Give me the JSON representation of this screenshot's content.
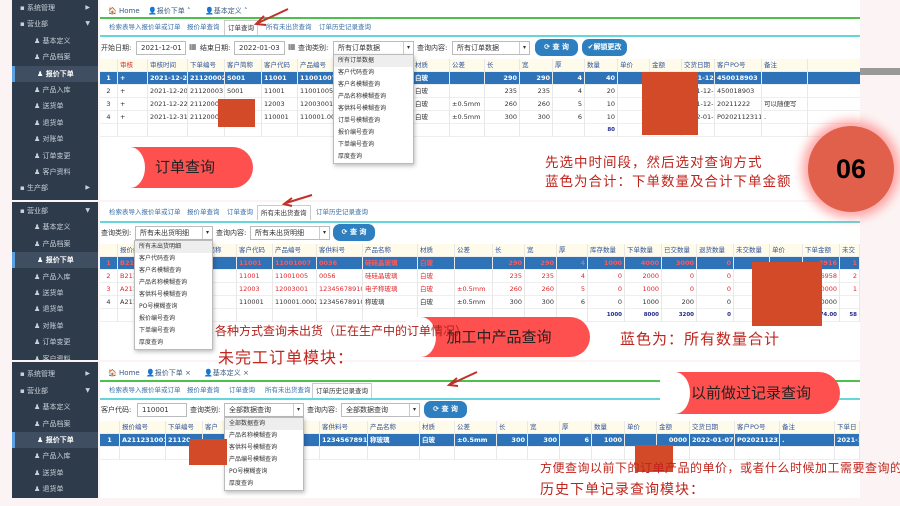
{
  "colors": {
    "accent": "#2d7fbf",
    "selected_row": "#2e72b8",
    "callout": "#ff5050",
    "note_text": "#c0241c",
    "redaction": "#d24a28"
  },
  "window_tabs": [
    {
      "label": "Home",
      "icon": "home-icon"
    },
    {
      "label": "报价下单",
      "icon": "user-icon"
    },
    {
      "label": "基本定义",
      "icon": "user-icon"
    }
  ],
  "sub_tabs": [
    "检索表导入报价单或订单",
    "报价单查询",
    "订单查询",
    "所有未出货查询",
    "订单历史记录查询"
  ],
  "sidebar": {
    "groups": [
      "系统管理",
      "营业部",
      "生产部"
    ],
    "items": [
      "基本定义",
      "产品档案",
      "报价下单",
      "产品入库",
      "送货单",
      "退货单",
      "对账单",
      "订单变更",
      "客户资料"
    ],
    "active": "报价下单"
  },
  "panel1": {
    "start_label": "开始日期:",
    "start_value": "2021-12-01",
    "end_label": "结束日期:",
    "end_value": "2022-01-03",
    "type_label": "查询类别:",
    "type_value": "所有订单数据",
    "content_label": "查询内容:",
    "content_value": "所有订单数据",
    "query_button": "查 询",
    "unlock_button": "解锁更改",
    "dropdown": [
      "所有订单数据",
      "客户代码查询",
      "客户名模糊查询",
      "产品名称模糊查询",
      "客供料号模糊查询",
      "订单号模糊查询",
      "报价编号查询",
      "下单编号查询",
      "厚度查询"
    ],
    "columns": [
      "",
      "审核",
      "审核时间",
      "下单编号",
      "客户简称",
      "客户代码",
      "产品编号",
      "",
      "称",
      "材质",
      "公差",
      "长",
      "宽",
      "厚",
      "数量",
      "单价",
      "金额",
      "交货日期",
      "客户PO号",
      "备注"
    ],
    "rows": [
      [
        "1",
        "+",
        "2021-12-20",
        "21120002",
        "S001",
        "11001",
        "11001007",
        "",
        "玻璃",
        "白玻",
        "",
        "290",
        "290",
        "4",
        "40",
        "",
        "3916",
        "2021-12-20",
        "450018903",
        ""
      ],
      [
        "2",
        "+",
        "2021-12-20",
        "21120003",
        "S001",
        "11001",
        "11001005",
        "",
        "玻璃",
        "白玻",
        "",
        "235",
        "235",
        "4",
        "20",
        "",
        "6958",
        "2021-12-20",
        "450018903",
        ""
      ],
      [
        "3",
        "+",
        "2021-12-22",
        "21120004",
        "",
        "12003",
        "12003001",
        "",
        "玻璃",
        "白玻",
        "±0.5mm",
        "260",
        "260",
        "5",
        "10",
        "",
        "0000",
        "2021-12-22",
        "20211222",
        "可以随便写"
      ],
      [
        "4",
        "+",
        "2021-12-31",
        "21120005",
        "",
        "110001",
        "110001.00",
        "",
        "",
        "白玻",
        "±0.5mm",
        "300",
        "300",
        "6",
        "10",
        "",
        "0000",
        "2022-01-07",
        "P0202112311",
        "."
      ]
    ],
    "total": [
      "",
      "",
      "",
      "",
      "",
      "",
      "",
      "",
      "",
      "",
      "",
      "",
      "",
      "",
      "80",
      "",
      "74.00",
      "",
      "",
      ""
    ],
    "callout": "订单查询",
    "note_lines": [
      "先选中时间段，然后选对查询方式",
      "蓝色为合计：下单数量及合计下单金额"
    ],
    "badge": "06"
  },
  "panel2": {
    "type_label": "查询类别:",
    "type_value": "所有未出货明细",
    "content_label": "查询内容:",
    "content_value": "所有未出货明细",
    "query_button": "查 询",
    "dropdown": [
      "所有未出货明细",
      "客户代码查询",
      "客户名模糊查询",
      "产品名称模糊查询",
      "客供料号模糊查询",
      "PO号模糊查询",
      "报价编号查询",
      "下单编号查询",
      "厚度查询"
    ],
    "columns": [
      "",
      "报价编号",
      "",
      "户简称",
      "客户代码",
      "产品编号",
      "客供料号",
      "产品名称",
      "材质",
      "公差",
      "长",
      "宽",
      "厚",
      "库存数量",
      "下单数量",
      "已交数量",
      "退货数量",
      "未交数量",
      "单价",
      "下单金额",
      "未交"
    ],
    "rows": [
      [
        "1",
        "B211",
        "",
        "",
        "11001",
        "11001007",
        "0036",
        "硅硅晶玻璃",
        "白玻",
        "",
        "290",
        "290",
        "4",
        "1000",
        "4000",
        "3000",
        "0",
        "",
        "",
        "3916",
        "1"
      ],
      [
        "2",
        "B211",
        "",
        "",
        "11001",
        "11001005",
        "0056",
        "硅硅晶玻璃",
        "白玻",
        "",
        "235",
        "235",
        "4",
        "0",
        "2000",
        "0",
        "0",
        "",
        "",
        "6958",
        "2"
      ],
      [
        "3",
        "A211",
        "",
        "",
        "12003",
        "12003001",
        "12345678910",
        "电子称玻璃",
        "白玻",
        "±0.5mm",
        "260",
        "260",
        "5",
        "0",
        "1000",
        "0",
        "0",
        "",
        "",
        "0000",
        "1"
      ],
      [
        "4",
        "A211",
        "",
        "",
        "110001",
        "110001.0002",
        "12345678910",
        "称玻璃",
        "白玻",
        "±0.5mm",
        "300",
        "300",
        "6",
        "0",
        "1000",
        "200",
        "0",
        "",
        "",
        "0000",
        ""
      ]
    ],
    "total": [
      "",
      "",
      "",
      "",
      "",
      "",
      "",
      "",
      "",
      "",
      "",
      "",
      "",
      "1000",
      "8000",
      "3200",
      "0",
      "",
      "",
      "74.00",
      "58"
    ],
    "note_top": "各种方式查询未出货（正在生产中的订单情况）",
    "callout": "加工中产品查询",
    "module_title": "未完工订单模块：",
    "note_right": "蓝色为：所有数量合计"
  },
  "panel3": {
    "code_label": "客户代码:",
    "code_value": "110001",
    "type_label": "查询类别:",
    "type_value": "全部数据查询",
    "content_label": "查询内容:",
    "content_value": "全部数据查询",
    "query_button": "查 询",
    "dropdown": [
      "全部数据查询",
      "产品名称模糊查询",
      "客供料号模糊查询",
      "产品编号模糊查询",
      "PO号模糊查询",
      "厚度查询"
    ],
    "columns": [
      "",
      "报价编号",
      "下单编号",
      "客户",
      "",
      "号",
      "客供料号",
      "产品名称",
      "材质",
      "公差",
      "长",
      "宽",
      "厚",
      "数量",
      "单价",
      "金额",
      "交货日期",
      "客户PO号",
      "备注",
      "下单日"
    ],
    "rows": [
      [
        "1",
        "A211231001",
        "21120",
        "",
        "",
        "0002",
        "12345678910",
        "称玻璃",
        "白玻",
        "±0.5mm",
        "300",
        "300",
        "6",
        "1000",
        "",
        "0000",
        "2022-01-07",
        "P0202112311",
        ".",
        "2021-1"
      ]
    ],
    "callout": "以前做过记录查询",
    "note_lines": [
      "方便查询以前下的订单产品的单价，或者什么时候加工需要查询的产品",
      "历史下单记录查询模块："
    ]
  }
}
